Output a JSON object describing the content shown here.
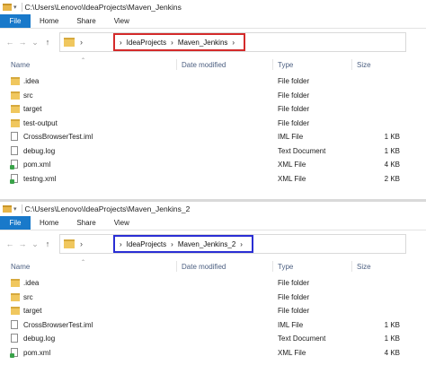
{
  "window1": {
    "title": "C:\\Users\\Lenovo\\IdeaProjects\\Maven_Jenkins",
    "ribbon": {
      "file": "File",
      "tabs": [
        "Home",
        "Share",
        "View"
      ]
    },
    "address": {
      "chevron": "›",
      "crumbs": [
        "IdeaProjects",
        "Maven_Jenkins"
      ],
      "highlight_color": "#d42a2a"
    },
    "columns": {
      "name": "Name",
      "date": "Date modified",
      "type": "Type",
      "size": "Size"
    },
    "files": [
      {
        "name": ".idea",
        "type": "File folder",
        "size": "",
        "icon": "folder-icon"
      },
      {
        "name": "src",
        "type": "File folder",
        "size": "",
        "icon": "folder-icon"
      },
      {
        "name": "target",
        "type": "File folder",
        "size": "",
        "icon": "folder-icon"
      },
      {
        "name": "test-output",
        "type": "File folder",
        "size": "",
        "icon": "folder-icon"
      },
      {
        "name": "CrossBrowserTest.iml",
        "type": "IML File",
        "size": "1 KB",
        "icon": "file-icon"
      },
      {
        "name": "debug.log",
        "type": "Text Document",
        "size": "1 KB",
        "icon": "file-icon"
      },
      {
        "name": "pom.xml",
        "type": "XML File",
        "size": "4 KB",
        "icon": "xml-file-icon"
      },
      {
        "name": "testng.xml",
        "type": "XML File",
        "size": "2 KB",
        "icon": "xml-file-icon"
      }
    ]
  },
  "window2": {
    "title": "C:\\Users\\Lenovo\\IdeaProjects\\Maven_Jenkins_2",
    "ribbon": {
      "file": "File",
      "tabs": [
        "Home",
        "Share",
        "View"
      ]
    },
    "address": {
      "chevron": "›",
      "crumbs": [
        "IdeaProjects",
        "Maven_Jenkins_2"
      ],
      "highlight_color": "#2a2ed4"
    },
    "columns": {
      "name": "Name",
      "date": "Date modified",
      "type": "Type",
      "size": "Size"
    },
    "files": [
      {
        "name": ".idea",
        "type": "File folder",
        "size": "",
        "icon": "folder-icon"
      },
      {
        "name": "src",
        "type": "File folder",
        "size": "",
        "icon": "folder-icon"
      },
      {
        "name": "target",
        "type": "File folder",
        "size": "",
        "icon": "folder-icon"
      },
      {
        "name": "CrossBrowserTest.iml",
        "type": "IML File",
        "size": "1 KB",
        "icon": "file-icon"
      },
      {
        "name": "debug.log",
        "type": "Text Document",
        "size": "1 KB",
        "icon": "file-icon"
      },
      {
        "name": "pom.xml",
        "type": "XML File",
        "size": "4 KB",
        "icon": "xml-file-icon"
      }
    ]
  }
}
